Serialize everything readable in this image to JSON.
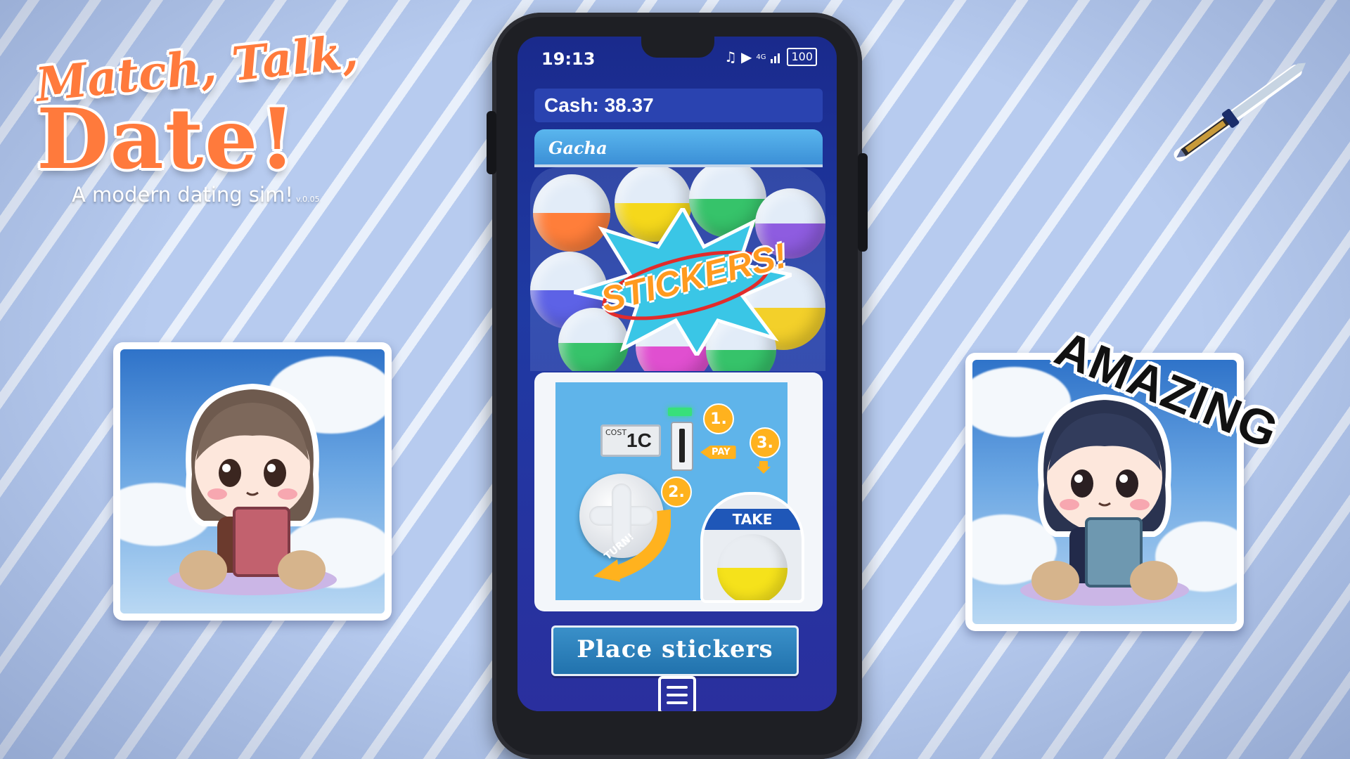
{
  "logo": {
    "line1": "Match, Talk,",
    "line2": "Date!",
    "subtitle": "A modern dating sim!",
    "version": "v.0.05"
  },
  "stickers_decor": {
    "amazing_text": "AMAZING"
  },
  "phone": {
    "status": {
      "time": "19:13",
      "network": "4G",
      "battery": "100"
    },
    "cash": {
      "label": "Cash: 38.37"
    },
    "gacha": {
      "title": "Gacha",
      "banner": "STICKERS!",
      "cost_label": "COST",
      "cost_value": "1C",
      "step1": "1.",
      "step1_label": "PAY",
      "step2": "2.",
      "step2_label": "TURN!",
      "step3": "3.",
      "take_label": "TAKE"
    },
    "place_button": "Place stickers",
    "menu_icon": "hamburger-menu-icon"
  },
  "colors": {
    "accent_orange": "#ffb21e",
    "button_blue": "#2172ad",
    "screen_blue": "#1f3aa3",
    "machine_blue": "#5fb4ea"
  }
}
